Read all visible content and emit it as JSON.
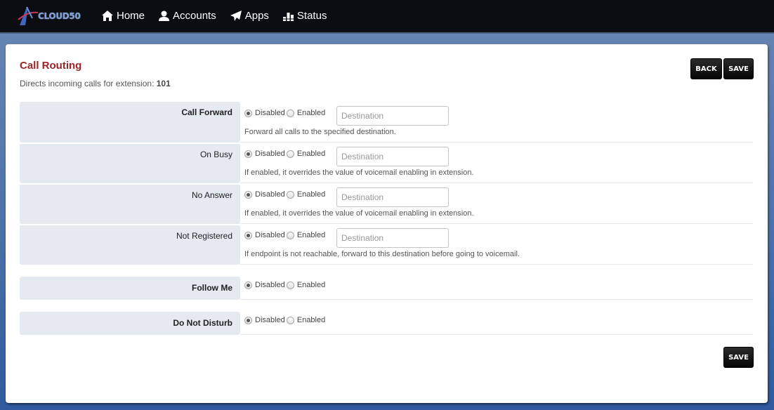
{
  "navbar": {
    "logo_text": "CLOUD50",
    "items": [
      {
        "label": "Home",
        "icon": "home-icon"
      },
      {
        "label": "Accounts",
        "icon": "user-icon"
      },
      {
        "label": "Apps",
        "icon": "send-icon"
      },
      {
        "label": "Status",
        "icon": "stats-icon"
      }
    ]
  },
  "page": {
    "title": "Call Routing",
    "subtitle_prefix": "Directs incoming calls for extension: ",
    "extension": "101",
    "back_label": "BACK",
    "save_label": "SAVE",
    "save_bottom_label": "SAVE"
  },
  "rows": [
    {
      "label": "Call Forward",
      "selected": "Disabled",
      "placeholder": "Destination",
      "value": "",
      "help": "Forward all calls to the specified destination."
    },
    {
      "label": "On Busy",
      "selected": "Disabled",
      "placeholder": "Destination",
      "value": "",
      "help": "If enabled, it overrides the value of voicemail enabling in extension."
    },
    {
      "label": "No Answer",
      "selected": "Disabled",
      "placeholder": "Destination",
      "value": "",
      "help": "If enabled, it overrides the value of voicemail enabling in extension."
    },
    {
      "label": "Not Registered",
      "selected": "Disabled",
      "placeholder": "Destination",
      "value": "",
      "help": "If endpoint is not reachable, forward to this destination before going to voicemail."
    },
    {
      "label": "Follow Me",
      "selected": "Disabled"
    },
    {
      "label": "Do Not Disturb",
      "selected": "Disabled"
    }
  ],
  "radio_options": {
    "disabled": "Disabled",
    "enabled": "Enabled"
  }
}
